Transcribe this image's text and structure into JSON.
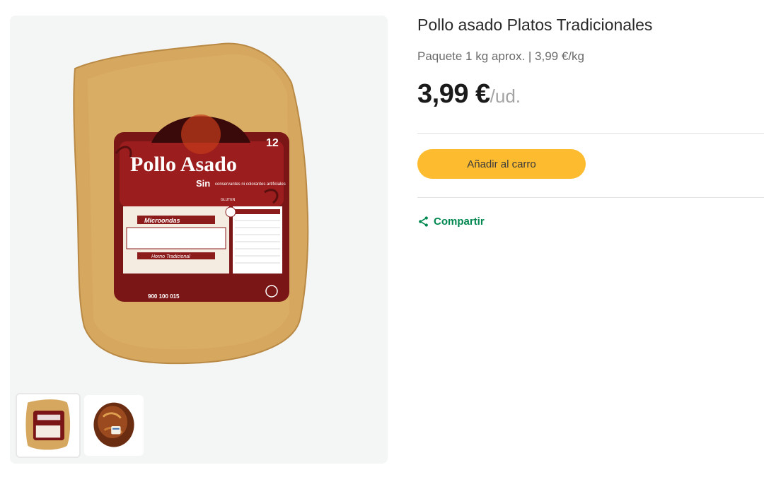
{
  "product": {
    "title": "Pollo asado Platos Tradicionales",
    "subtitle": "Paquete 1 kg aprox. | 3,99 €/kg",
    "price": "3,99 €",
    "unit": "/ud."
  },
  "package_label": {
    "brand_line": "Pollo Asado",
    "sin": "Sin",
    "claim": "conservantes ni colorantes artificiales",
    "badge": "12",
    "microondas": "Microondas",
    "horno": "Horno Tradicional",
    "gluten": "GLUTEN",
    "phone": "900 100 015"
  },
  "actions": {
    "add_to_cart": "Añadir al carro",
    "share": "Compartir"
  },
  "colors": {
    "accent_button": "#fdbb2f",
    "share_green": "#00874f",
    "gallery_bg": "#f4f5f5"
  }
}
